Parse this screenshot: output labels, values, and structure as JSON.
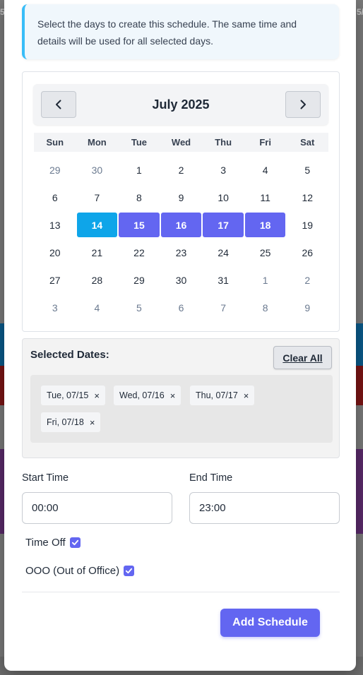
{
  "background": {
    "left_glimpse_top": "5",
    "right_glimpse_top": "5/"
  },
  "info": {
    "text": "Select the days to create this schedule. The same time and details will be used for all selected days."
  },
  "calendar": {
    "month_label": "July 2025",
    "prev_icon": "chevron-left-icon",
    "next_icon": "chevron-right-icon",
    "weekdays": [
      "Sun",
      "Mon",
      "Tue",
      "Wed",
      "Thu",
      "Fri",
      "Sat"
    ],
    "weeks": [
      [
        {
          "d": "29",
          "m": true
        },
        {
          "d": "30",
          "m": true
        },
        {
          "d": "1"
        },
        {
          "d": "2"
        },
        {
          "d": "3"
        },
        {
          "d": "4"
        },
        {
          "d": "5"
        }
      ],
      [
        {
          "d": "6"
        },
        {
          "d": "7"
        },
        {
          "d": "8"
        },
        {
          "d": "9"
        },
        {
          "d": "10"
        },
        {
          "d": "11"
        },
        {
          "d": "12"
        }
      ],
      [
        {
          "d": "13"
        },
        {
          "d": "14",
          "today": true
        },
        {
          "d": "15",
          "sel": true
        },
        {
          "d": "16",
          "sel": true
        },
        {
          "d": "17",
          "sel": true
        },
        {
          "d": "18",
          "sel": true
        },
        {
          "d": "19"
        }
      ],
      [
        {
          "d": "20"
        },
        {
          "d": "21"
        },
        {
          "d": "22"
        },
        {
          "d": "23"
        },
        {
          "d": "24"
        },
        {
          "d": "25"
        },
        {
          "d": "26"
        }
      ],
      [
        {
          "d": "27"
        },
        {
          "d": "28"
        },
        {
          "d": "29"
        },
        {
          "d": "30"
        },
        {
          "d": "31"
        },
        {
          "d": "1",
          "m": true
        },
        {
          "d": "2",
          "m": true
        }
      ],
      [
        {
          "d": "3",
          "m": true
        },
        {
          "d": "4",
          "m": true
        },
        {
          "d": "5",
          "m": true
        },
        {
          "d": "6",
          "m": true
        },
        {
          "d": "7",
          "m": true
        },
        {
          "d": "8",
          "m": true
        },
        {
          "d": "9",
          "m": true
        }
      ]
    ],
    "colors": {
      "today": "#0ea5e9",
      "selected": "#6366f1"
    }
  },
  "selected_dates": {
    "title": "Selected Dates:",
    "clear_label": "Clear All",
    "chips": [
      "Tue, 07/15",
      "Wed, 07/16",
      "Thu, 07/17",
      "Fri, 07/18"
    ],
    "remove_glyph": "×"
  },
  "times": {
    "start_label": "Start Time",
    "start_value": "00:00",
    "end_label": "End Time",
    "end_value": "23:00"
  },
  "options": {
    "time_off_label": "Time Off",
    "time_off_checked": true,
    "ooo_label": "OOO (Out of Office)",
    "ooo_checked": true
  },
  "actions": {
    "add_label": "Add Schedule"
  },
  "theme": {
    "accent": "#6366f1",
    "info_border": "#38bdf8"
  }
}
